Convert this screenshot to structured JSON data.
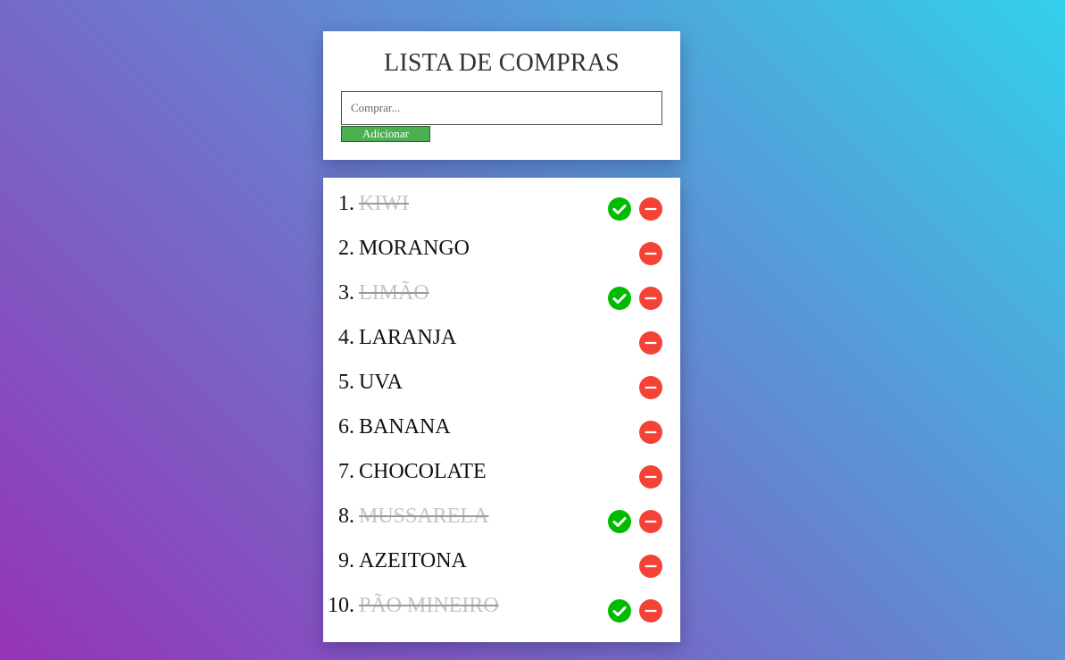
{
  "header": {
    "title": "LISTA DE COMPRAS"
  },
  "form": {
    "placeholder": "Comprar...",
    "value": "",
    "add_label": "Adicionar"
  },
  "items": [
    {
      "number": "1.",
      "name": "KIWI",
      "done": true
    },
    {
      "number": "2.",
      "name": "MORANGO",
      "done": false
    },
    {
      "number": "3.",
      "name": "LIMÃO",
      "done": true
    },
    {
      "number": "4.",
      "name": "LARANJA",
      "done": false
    },
    {
      "number": "5.",
      "name": "UVA",
      "done": false
    },
    {
      "number": "6.",
      "name": "BANANA",
      "done": false
    },
    {
      "number": "7.",
      "name": "CHOCOLATE",
      "done": false
    },
    {
      "number": "8.",
      "name": "MUSSARELA",
      "done": true
    },
    {
      "number": "9.",
      "name": "AZEITONA",
      "done": false
    },
    {
      "number": "10.",
      "name": "PÃO MINEIRO",
      "done": true
    }
  ],
  "icons": {
    "check": "check-circle-icon",
    "remove": "minus-circle-icon"
  },
  "colors": {
    "check": "#00bb00",
    "remove": "#f44336",
    "add_button": "#4caf50",
    "done_text": "#c4c4c4"
  }
}
